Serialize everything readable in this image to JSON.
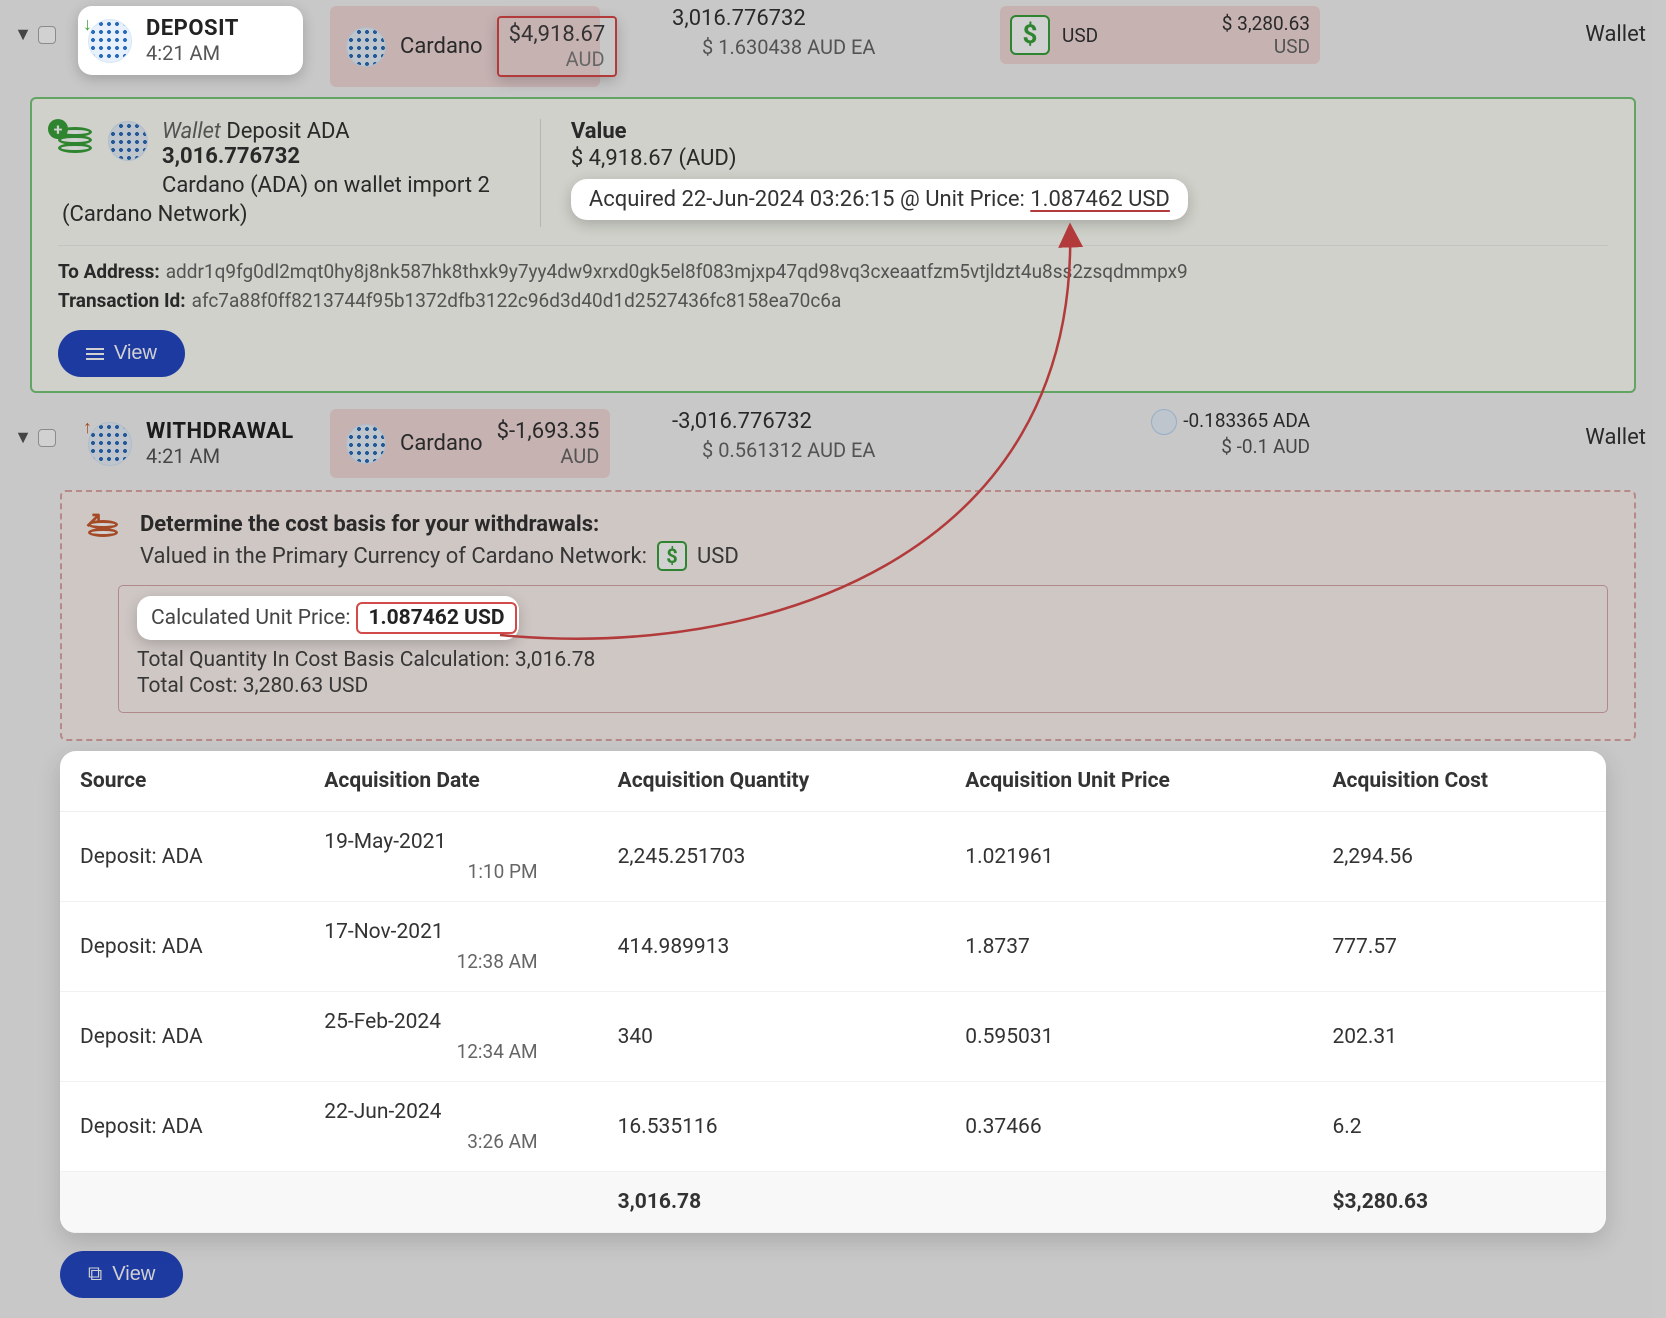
{
  "deposit": {
    "label": "DEPOSIT",
    "time": "4:21 AM",
    "asset": "Cardano",
    "amount": "$4,918.67",
    "amount_ccy": "AUD",
    "qty": "3,016.776732",
    "rate": "$ 1.630438 AUD EA",
    "usd_label": "USD",
    "usd_amount": "$ 3,280.63",
    "usd_ccy": "USD",
    "source": "Wallet"
  },
  "deposit_detail": {
    "wallet_prefix": "Wallet",
    "wallet_suffix": "Deposit ADA",
    "qty": "3,016.776732",
    "desc": "Cardano (ADA) on wallet import 2",
    "network": "(Cardano Network)",
    "value_label": "Value",
    "value": "$ 4,918.67 (AUD)",
    "acq_prefix": "Acquired 22-Jun-2024 03:26:15  @ Unit Price: ",
    "acq_price": "1.087462 USD",
    "to_label": "To Address:",
    "to_addr": "addr1q9fg0dl2mqt0hy8j8nk587hk8thxk9y7yy4dw9xrxd0gk5el8f083mjxp47qd98vq3cxeaatfzm5vtjldzt4u8ss2zsqdmmpx9",
    "txid_label": "Transaction Id:",
    "txid": "afc7a88f0ff8213744f95b1372dfb3122c96d3d40d1d2527436fc8158ea70c6a",
    "view": "View"
  },
  "withdrawal": {
    "label": "WITHDRAWAL",
    "time": "4:21 AM",
    "asset": "Cardano",
    "amount": "$-1,693.35",
    "amount_ccy": "AUD",
    "qty": "-3,016.776732",
    "rate": "$ 0.561312 AUD EA",
    "fee_qty": "-0.183365 ADA",
    "fee_val": "$ -0.1 AUD",
    "source": "Wallet"
  },
  "cost_basis": {
    "title": "Determine the cost basis for your withdrawals:",
    "subtitle": "Valued in the Primary Currency of Cardano Network:",
    "sub_ccy": "USD",
    "cup_label": "Calculated Unit Price:",
    "cup_value": "1.087462 USD",
    "total_qty": "Total Quantity In Cost Basis Calculation: 3,016.78",
    "total_cost": "Total Cost: 3,280.63 USD"
  },
  "table": {
    "headers": {
      "source": "Source",
      "date": "Acquisition Date",
      "qty": "Acquisition Quantity",
      "unit": "Acquisition Unit Price",
      "cost": "Acquisition Cost"
    },
    "rows": [
      {
        "source": "Deposit: ADA",
        "date": "19-May-2021",
        "time": "1:10 PM",
        "qty": "2,245.251703",
        "unit": "1.021961",
        "cost": "2,294.56"
      },
      {
        "source": "Deposit: ADA",
        "date": "17-Nov-2021",
        "time": "12:38 AM",
        "qty": "414.989913",
        "unit": "1.8737",
        "cost": "777.57"
      },
      {
        "source": "Deposit: ADA",
        "date": "25-Feb-2024",
        "time": "12:34 AM",
        "qty": "340",
        "unit": "0.595031",
        "cost": "202.31"
      },
      {
        "source": "Deposit: ADA",
        "date": "22-Jun-2024",
        "time": "3:26 AM",
        "qty": "16.535116",
        "unit": "0.37466",
        "cost": "6.2"
      }
    ],
    "footer": {
      "qty": "3,016.78",
      "cost": "$3,280.63"
    }
  },
  "view2": "View"
}
